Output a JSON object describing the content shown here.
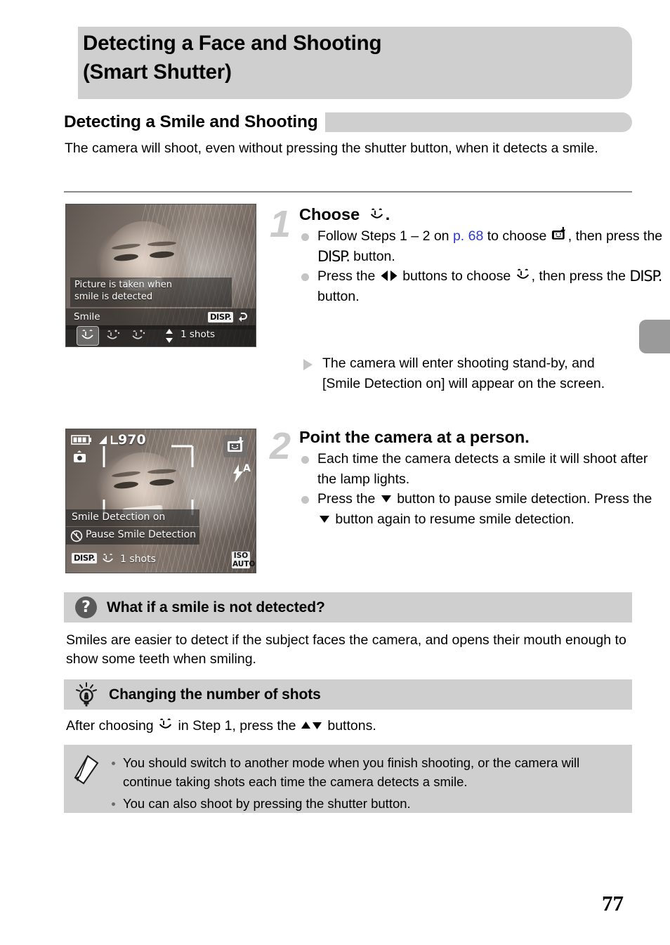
{
  "page": {
    "number": "77",
    "title": "Detecting a Face and Shooting (Smart Shutter)",
    "title_line1": "Detecting a Face and Shooting",
    "title_line2": "(Smart Shutter)"
  },
  "section": {
    "heading": "Detecting a Smile and Shooting",
    "intro": "The camera will shoot, even without pressing the shutter button, when it detects a smile."
  },
  "steps": [
    {
      "number": "1",
      "title_prefix": "Choose",
      "title_icon": "smile-icon",
      "title_suffix": ".",
      "bullets": [
        {
          "part1": "Follow Steps 1 – 2 on ",
          "link": "p. 68",
          "part2": " to choose ",
          "icon": "camera-smile-icon",
          "part3": ", then press the ",
          "button": "DISP.",
          "part4": " button."
        },
        {
          "part1": "Press the ",
          "icon": "left-right-arrows-icon",
          "part2": " buttons to choose ",
          "icon2": "smile-icon",
          "part3": ", then press the ",
          "button": "DISP.",
          "part4": " button."
        }
      ],
      "result": "The camera will enter shooting stand-by, and [Smile Detection on] will appear on the screen."
    },
    {
      "number": "2",
      "title_prefix": "Point the camera at a person.",
      "bullets": [
        {
          "part1": "Each time the camera detects a smile it will shoot after the lamp lights."
        },
        {
          "part1": "Press the ",
          "icon": "down-arrow-icon",
          "part2": " button to pause smile detection. Press the ",
          "icon2": "down-arrow-icon",
          "part3": " button again to resume smile detection."
        }
      ]
    }
  ],
  "camera_screens": [
    {
      "name": "smart-shutter-mode-select-screen",
      "message_line1": "Picture is taken when",
      "message_line2": "smile is detected",
      "mode_label": "Smile",
      "disp_chip": "DISP.",
      "back_icon": "return-arrow-icon",
      "mode_icons": [
        "smile-icon",
        "wink-self-timer-icon",
        "face-self-timer-icon"
      ],
      "shots_arrows_icon": "up-down-arrows-icon",
      "shots_value": "1 shots"
    },
    {
      "name": "smile-detection-standby-screen",
      "battery_icon": "battery-icon",
      "quality_icon": "image-quality-icon",
      "remaining_shots": "970",
      "flash_mode_icon": "camera-mode-icon",
      "face_mode_icon": "smart-shutter-icon",
      "flash_icon": "flash-auto-icon",
      "flash_label": "A",
      "status_line1": "Smile Detection on",
      "status_line2": "Pause Smile Detection",
      "pause_icon": "self-timer-icon",
      "disp_chip": "DISP.",
      "bottom_mode_icon": "smile-icon",
      "bottom_shots": "1 shots",
      "iso_line1": "ISO",
      "iso_line2": "AUTO"
    }
  ],
  "tips": [
    {
      "icon": "question-mark-icon",
      "title": "What if a smile is not detected?",
      "body": "Smiles are easier to detect if the subject faces the camera, and opens their mouth enough to show some teeth when smiling."
    },
    {
      "icon": "lightbulb-icon",
      "title": "Changing the number of shots",
      "body_part1": "After choosing ",
      "body_icon": "smile-icon",
      "body_part2": " in Step 1, press the ",
      "body_arrows": "up-down-arrows-icon",
      "body_part3": " buttons."
    }
  ],
  "note": {
    "icon": "pencil-icon",
    "items": [
      "You should switch to another mode when you finish shooting, or the camera will continue taking shots each time the camera detects a smile.",
      "You can also shoot by pressing the shutter button."
    ]
  },
  "colors": {
    "gray_band": "#cfcfcf",
    "link": "#2b3ad0",
    "step_number": "#cacaca",
    "tab": "#9a9a9a"
  }
}
